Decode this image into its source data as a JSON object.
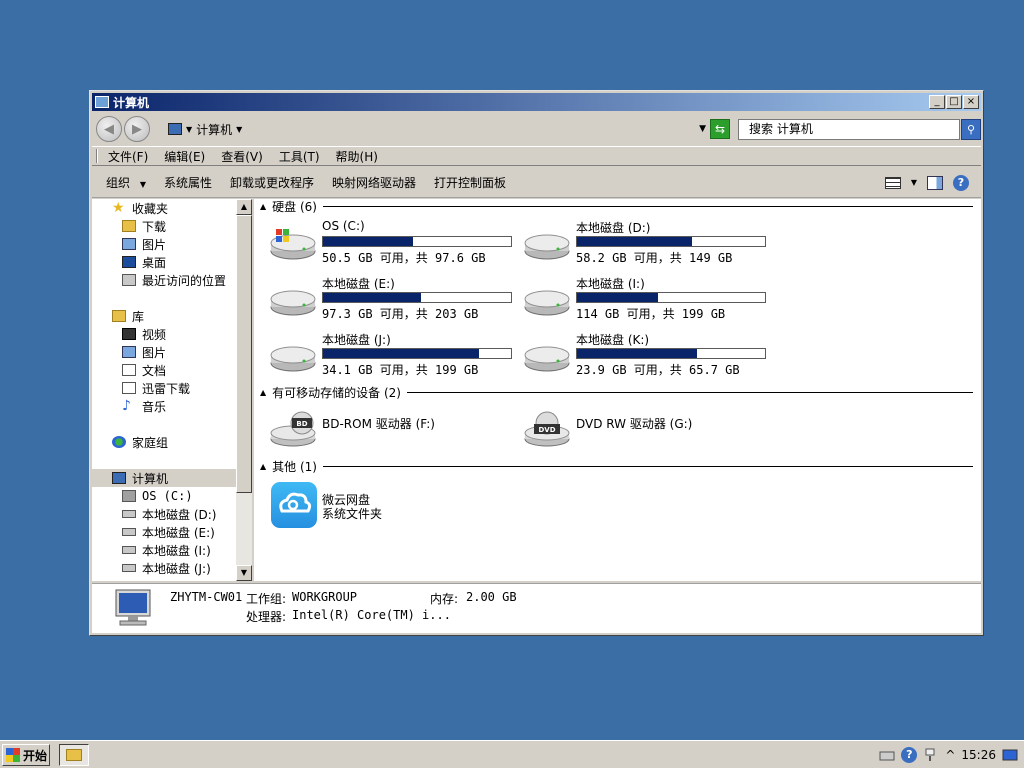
{
  "window": {
    "title": "计算机",
    "controls": {
      "minimize": "_",
      "maximize": "□",
      "close": "×"
    }
  },
  "address": {
    "crumb": "计算机",
    "search_placeholder": "搜索 计算机"
  },
  "menu": [
    "文件(F)",
    "编辑(E)",
    "查看(V)",
    "工具(T)",
    "帮助(H)"
  ],
  "toolbar": {
    "organize": "组织",
    "system_properties": "系统属性",
    "uninstall": "卸载或更改程序",
    "map_drive": "映射网络驱动器",
    "control_panel": "打开控制面板"
  },
  "nav": {
    "favorites": "收藏夹",
    "fav_items": [
      "下载",
      "图片",
      "桌面",
      "最近访问的位置"
    ],
    "libraries": "库",
    "lib_items": [
      "视频",
      "图片",
      "文档",
      "迅雷下载",
      "音乐"
    ],
    "homegroup": "家庭组",
    "computer": "计算机",
    "computer_items": [
      "OS (C:)",
      "本地磁盘 (D:)",
      "本地磁盘 (E:)",
      "本地磁盘 (I:)",
      "本地磁盘 (J:)"
    ]
  },
  "groups": {
    "hard_disks": "硬盘 (6)",
    "removable": "有可移动存储的设备 (2)",
    "other": "其他 (1)"
  },
  "drives": [
    {
      "name": "OS (C:)",
      "space": "50.5 GB 可用，共 97.6 GB",
      "used_fraction": 0.48
    },
    {
      "name": "本地磁盘 (D:)",
      "space": "58.2 GB 可用，共 149 GB",
      "used_fraction": 0.61
    },
    {
      "name": "本地磁盘 (E:)",
      "space": "97.3 GB 可用，共 203 GB",
      "used_fraction": 0.52
    },
    {
      "name": "本地磁盘 (I:)",
      "space": "114 GB 可用，共 199 GB",
      "used_fraction": 0.43
    },
    {
      "name": "本地磁盘 (J:)",
      "space": "34.1 GB 可用，共 199 GB",
      "used_fraction": 0.83
    },
    {
      "name": "本地磁盘 (K:)",
      "space": "23.9 GB 可用，共 65.7 GB",
      "used_fraction": 0.64
    }
  ],
  "removable": [
    {
      "name": "BD-ROM 驱动器 (F:)",
      "badge": "BD"
    },
    {
      "name": "DVD RW 驱动器 (G:)",
      "badge": "DVD"
    }
  ],
  "other": {
    "name": "微云网盘",
    "type": "系统文件夹"
  },
  "details": {
    "computer_name": "ZHYTM-CW01",
    "workgroup_label": "工作组:",
    "workgroup": "WORKGROUP",
    "memory_label": "内存:",
    "memory": "2.00 GB",
    "processor_label": "处理器:",
    "processor": "Intel(R) Core(TM) i..."
  },
  "taskbar": {
    "start": "开始",
    "clock": "15:26"
  },
  "colors": {
    "desktop": "#3a6ea5",
    "title_start": "#0a246a",
    "bar_fill": "#0a246a"
  }
}
